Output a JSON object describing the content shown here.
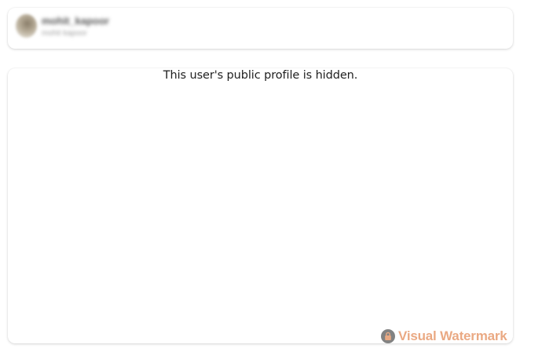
{
  "profile_header": {
    "username": "mohit_kapoor",
    "full_name": "mohit kapoor",
    "avatar_icon": "user-avatar"
  },
  "profile_content": {
    "message": "This user's public profile is hidden."
  },
  "watermark": {
    "text": "Visual Watermark",
    "icon": "lock-icon",
    "color": "#e79b6e"
  }
}
